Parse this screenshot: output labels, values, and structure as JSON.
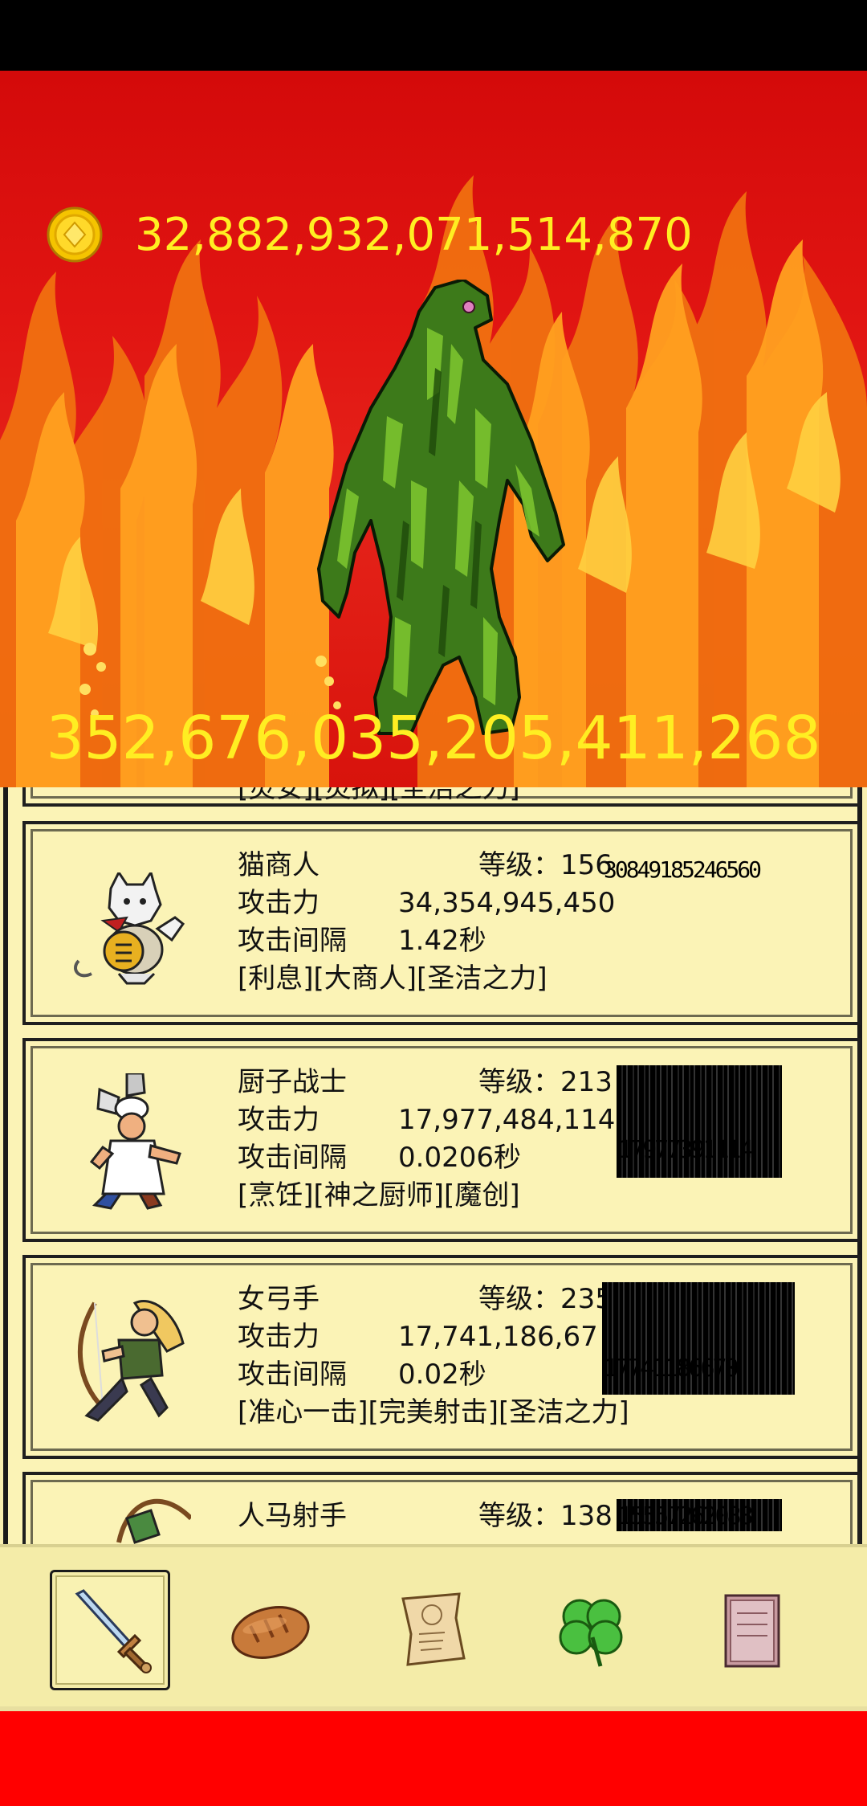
{
  "gold": {
    "amount": "32,882,932,071,514,870",
    "icon": "gold-coin-icon"
  },
  "boss": {
    "damage": "352,676,035,205,411,268",
    "icon": "green-swamp-monster"
  },
  "heroes": [
    {
      "partial_skills": "[灵安][灵拟][圣洁之力]"
    },
    {
      "name": "猫商人",
      "level": "等级：156",
      "level_overlay": "30849185246560",
      "attack_label": "攻击力",
      "attack": "34,354,945,450",
      "interval_label": "攻击间隔",
      "interval": "1.42秒",
      "skills": "[利息][大商人][圣洁之力]",
      "icon": "cat-merchant-icon"
    },
    {
      "name": "厨子战士",
      "level": "等级：213",
      "level_overlay": "17977391114",
      "attack_label": "攻击力",
      "attack": "17,977,484,114",
      "interval_label": "攻击间隔",
      "interval": "0.0206秒",
      "skills": "[烹饪][神之厨师][魔创]",
      "icon": "chef-warrior-icon"
    },
    {
      "name": "女弓手",
      "level": "等级：235",
      "level_overlay": "17741186670",
      "attack_label": "攻击力",
      "attack": "17,741,186,67",
      "interval_label": "攻击间隔",
      "interval": "0.02秒",
      "skills": "[准心一击][完美射击][圣洁之力]",
      "icon": "female-archer-icon"
    },
    {
      "name": "人马射手",
      "level": "等级：138",
      "level_overlay": "15557262088",
      "icon": "centaur-archer-icon"
    }
  ],
  "tabs": [
    {
      "name": "sword",
      "icon": "sword-icon",
      "active": true
    },
    {
      "name": "bread",
      "icon": "bread-icon",
      "active": false
    },
    {
      "name": "scroll",
      "icon": "scroll-icon",
      "active": false
    },
    {
      "name": "clover",
      "icon": "clover-icon",
      "active": false
    },
    {
      "name": "book",
      "icon": "book-icon",
      "active": false
    }
  ],
  "colors": {
    "gold_text": "#ffee22",
    "panel": "#fbf3b6",
    "bottom_bar": "#ff0000"
  }
}
